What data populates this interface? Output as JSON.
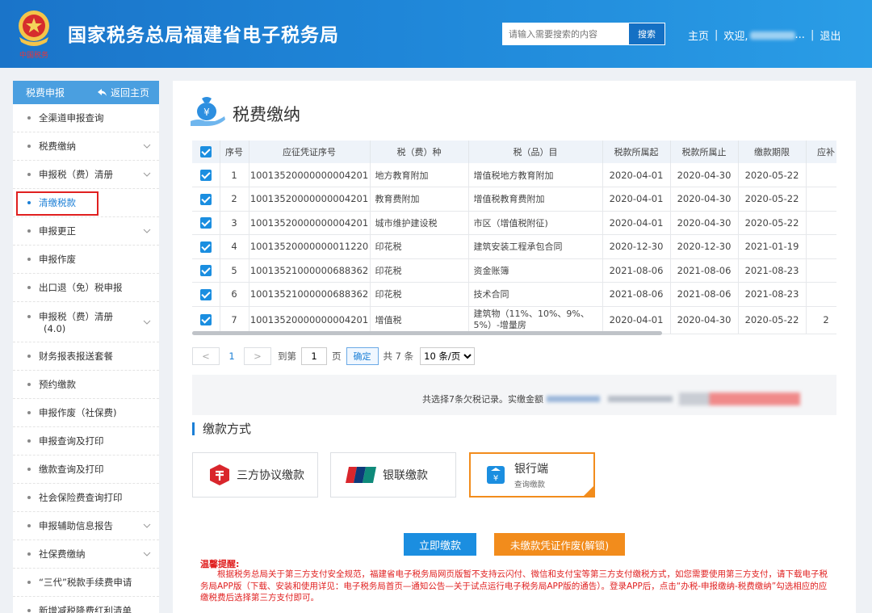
{
  "header": {
    "site_title": "国家税务总局福建省电子税务局",
    "search_placeholder": "请输入需要搜索的内容",
    "search_button": "搜索",
    "nav_home": "主页",
    "nav_sep": "|",
    "welcome": "欢迎,",
    "welcome_suffix": "...",
    "logout": "退出",
    "emblem_caption": "中国税务"
  },
  "sidebar": {
    "section_title": "税费申报",
    "back_label": "返回主页",
    "items": [
      {
        "label": "全渠道申报查询",
        "expandable": false
      },
      {
        "label": "税费缴纳",
        "expandable": true
      },
      {
        "label": "申报税（费）清册",
        "expandable": true
      },
      {
        "label": "清缴税款",
        "expandable": false,
        "active": true
      },
      {
        "label": "申报更正",
        "expandable": true
      },
      {
        "label": "申报作废",
        "expandable": false
      },
      {
        "label": "出口退（免）税申报",
        "expandable": false
      },
      {
        "label": "申报税（费）清册",
        "label_line2": "(4.0)",
        "expandable": true
      },
      {
        "label": "财务报表报送套餐",
        "expandable": false
      },
      {
        "label": "预约缴款",
        "expandable": false
      },
      {
        "label": "申报作废（社保费)",
        "expandable": false
      },
      {
        "label": "申报查询及打印",
        "expandable": false
      },
      {
        "label": "缴款查询及打印",
        "expandable": false
      },
      {
        "label": "社会保险费查询打印",
        "expandable": false
      },
      {
        "label": "申报辅助信息报告",
        "expandable": true
      },
      {
        "label": "社保费缴纳",
        "expandable": true
      },
      {
        "label": "“三代”税款手续费申请",
        "expandable": false
      },
      {
        "label": "新增减税降费红利清单",
        "expandable": false
      }
    ]
  },
  "main": {
    "page_title": "税费缴纳",
    "table": {
      "headers": [
        "序号",
        "应征凭证序号",
        "税（费）种",
        "税（品）目",
        "税款所属起",
        "税款所属止",
        "缴款期限",
        "应补"
      ],
      "rows": [
        [
          "1",
          "10013520000000004201",
          "地方教育附加",
          "增值税地方教育附加",
          "2020-04-01",
          "2020-04-30",
          "2020-05-22",
          ""
        ],
        [
          "2",
          "10013520000000004201",
          "教育费附加",
          "增值税教育费附加",
          "2020-04-01",
          "2020-04-30",
          "2020-05-22",
          ""
        ],
        [
          "3",
          "10013520000000004201",
          "城市维护建设税",
          "市区（增值税附征)",
          "2020-04-01",
          "2020-04-30",
          "2020-05-22",
          ""
        ],
        [
          "4",
          "10013520000000011220",
          "印花税",
          "建筑安装工程承包合同",
          "2020-12-30",
          "2020-12-30",
          "2021-01-19",
          ""
        ],
        [
          "5",
          "10013521000000688362",
          "印花税",
          "资金账簿",
          "2021-08-06",
          "2021-08-06",
          "2021-08-23",
          ""
        ],
        [
          "6",
          "10013521000000688362",
          "印花税",
          "技术合同",
          "2021-08-06",
          "2021-08-06",
          "2021-08-23",
          ""
        ],
        [
          "7",
          "10013520000000004201",
          "增值税",
          "建筑物（11%、10%、9%、5%）-增量房",
          "2020-04-01",
          "2020-04-30",
          "2020-05-22",
          "2"
        ]
      ]
    },
    "pager": {
      "prev": "<",
      "current_page": "1",
      "next": ">",
      "goto_label": "到第",
      "goto_value": "1",
      "page_unit": "页",
      "confirm": "确定",
      "total": "共 7 条",
      "page_size": "10 条/页"
    },
    "summary_text": "共选择7条欠税记录。实缴金额",
    "payment": {
      "section_title": "缴款方式",
      "methods": [
        {
          "label": "三方协议缴款",
          "icon": "tripartite-icon"
        },
        {
          "label": "银联缴款",
          "icon": "unionpay-icon"
        },
        {
          "label": "银行端",
          "sublabel": "查询缴款",
          "icon": "bank-yuan-icon",
          "selected": true
        }
      ]
    },
    "buttons": {
      "pay_now": "立即缴款",
      "unlock": "未缴款凭证作废(解锁)"
    },
    "tip": {
      "title": "温馨提醒:",
      "body": "根据税务总局关于第三方支付安全规范，福建省电子税务局网页版暂不支持云闪付、微信和支付宝等第三方支付缴税方式，如您需要使用第三方支付，请下载电子税务局APP版（下载、安装和使用详见：电子税务局首页—通知公告—关于试点运行电子税务局APP版的通告）。登录APP后，点击“办税-申报缴纳-税费缴纳”勾选相应的应缴税费后选择第三方支付即可。"
    }
  },
  "colors": {
    "header_blue": "#1f86d8",
    "accent_blue": "#1b7fd6",
    "orange": "#f28c1c",
    "warning_red": "#e02020"
  }
}
